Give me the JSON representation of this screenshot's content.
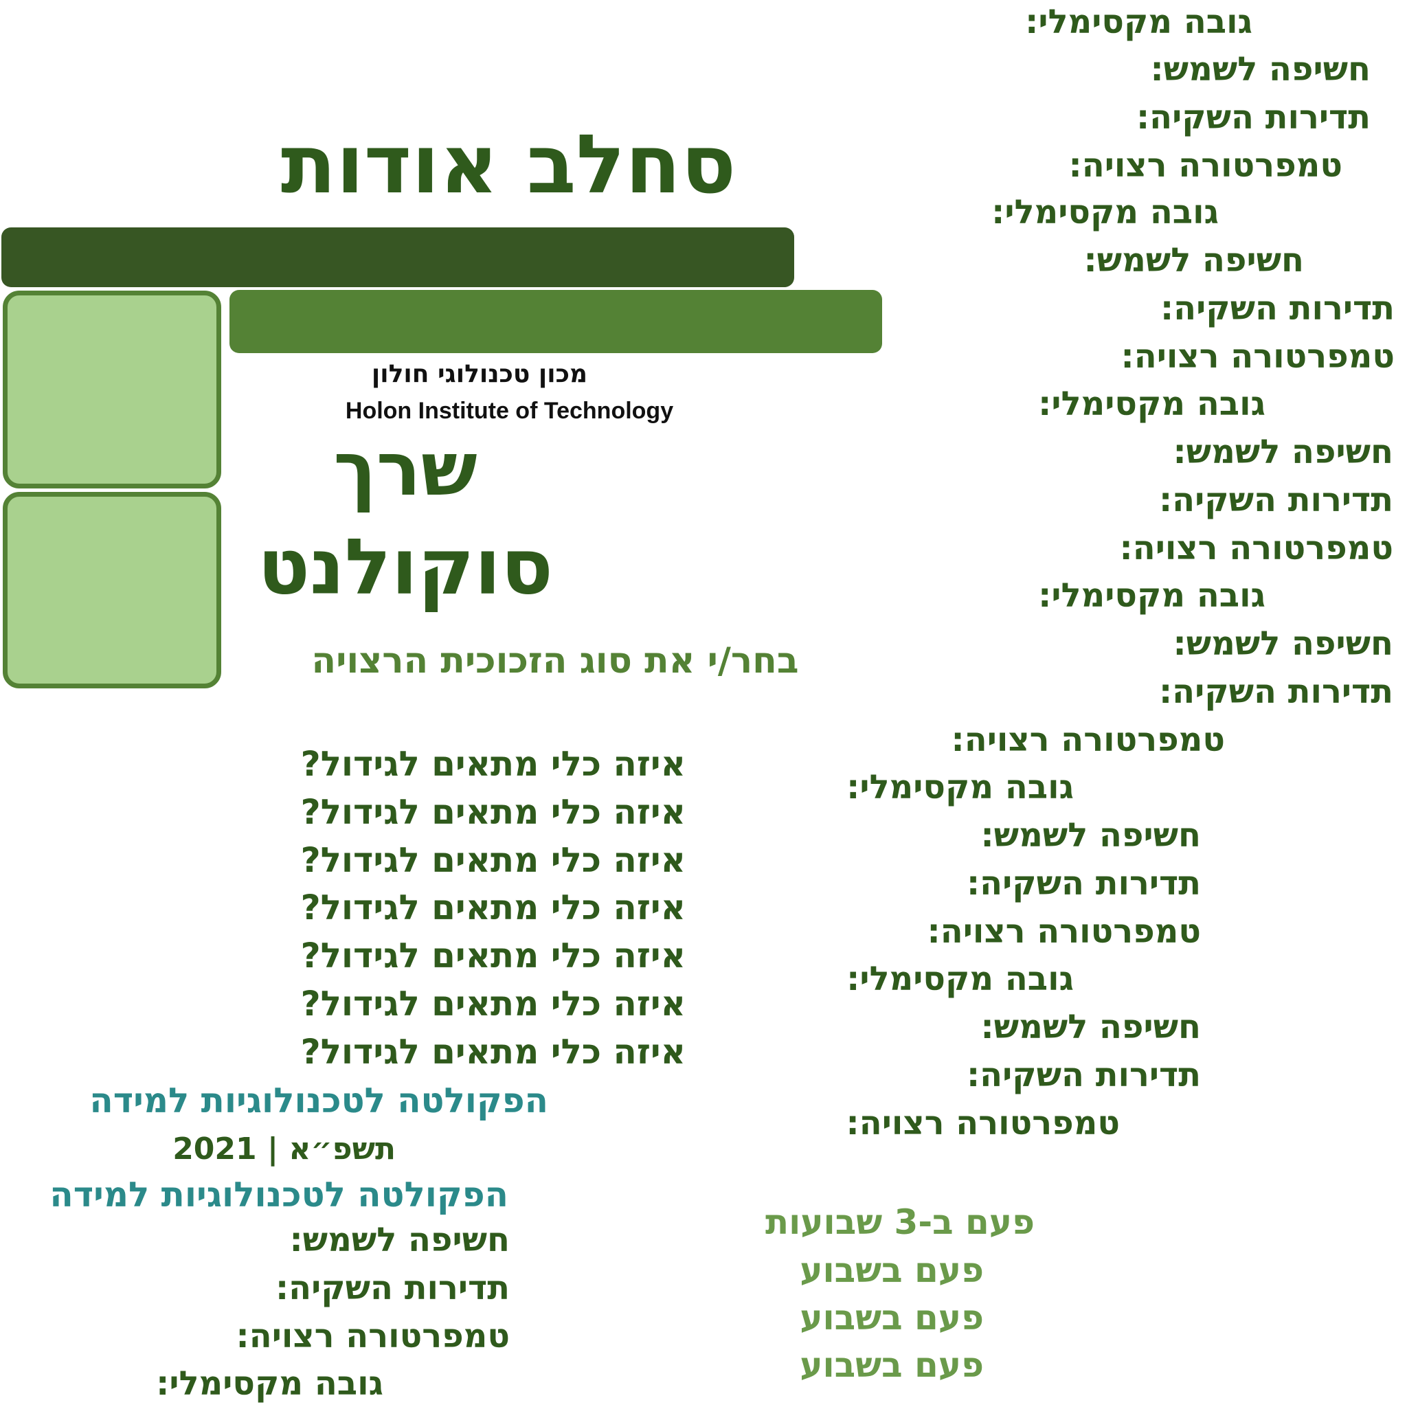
{
  "title": "סחלב  אודות",
  "institute": {
    "hebrew": "מכון טכנולוגי חולון",
    "english": "Holon Institute of Technology"
  },
  "plant": {
    "line1": "שרך",
    "line2": "סוקולנט"
  },
  "glass_prompt": "בחר/י את סוג הזכוכית הרצויה",
  "pot_question": "איזה כלי מתאים לגידול?",
  "faculty": "הפקולטה לטכנולוגיות למידה",
  "year": "תשפ״א | 2021",
  "labels": {
    "max_height": "גובה מקסימלי:",
    "sun": "חשיפה לשמש:",
    "watering": "תדירות השקיה:",
    "temperature": "טמפרטורה רצויה:"
  },
  "frequencies": {
    "three_weeks": "פעם ב-3 שבועות",
    "weekly": "פעם בשבוע"
  },
  "colors": {
    "dark_green": "#375623",
    "mid_green": "#548235",
    "light_green": "#a9d18e",
    "teal": "#2b8a8a"
  }
}
